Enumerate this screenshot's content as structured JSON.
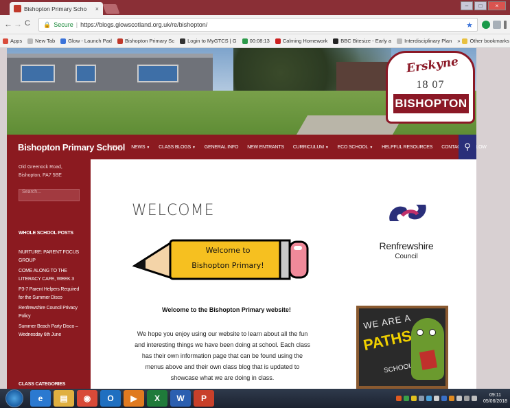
{
  "browser": {
    "tab_title": "Bishopton Primary Scho",
    "close_tab": "×",
    "secure_label": "Secure",
    "url": "https://blogs.glowscotland.org.uk/re/bishopton/",
    "back": "←",
    "forward": "→",
    "reload": "C",
    "window_controls": {
      "minimize": "–",
      "maximize": "□",
      "close": "×"
    }
  },
  "bookmarks": {
    "items": [
      {
        "label": "Apps",
        "color": "#d94c3c"
      },
      {
        "label": "New Tab",
        "color": "#bbbbbb"
      },
      {
        "label": "Glow - Launch Pad",
        "color": "#3b73d9"
      },
      {
        "label": "Bishopton Primary Sc",
        "color": "#c0392b"
      },
      {
        "label": "Login to MyGTCS | G",
        "color": "#333333"
      },
      {
        "label": "00:08:13",
        "color": "#2c9a4a"
      },
      {
        "label": "Calming Homework",
        "color": "#cc2020"
      },
      {
        "label": "BBC Bitesize - Early a",
        "color": "#222222"
      },
      {
        "label": "Interdisciplinary Plan",
        "color": "#bbbbbb"
      }
    ],
    "overflow": "»",
    "other": "Other bookmarks"
  },
  "logo": {
    "script": "Erskyne",
    "year": "18 07",
    "name": "BISHOPTON"
  },
  "nav": {
    "site_title": "Bishopton Primary School",
    "items": [
      {
        "label": "HOME",
        "caret": ""
      },
      {
        "label": "NEWS",
        "caret": "▼"
      },
      {
        "label": "CLASS BLOGS",
        "caret": "▼"
      },
      {
        "label": "GENERAL INFO",
        "caret": ""
      },
      {
        "label": "NEW ENTRANTS",
        "caret": ""
      },
      {
        "label": "CURRICULUM",
        "caret": "▼"
      },
      {
        "label": "ECO SCHOOL",
        "caret": "▼"
      },
      {
        "label": "HELPFUL RESOURCES",
        "caret": ""
      },
      {
        "label": "CONTACT",
        "caret": ""
      },
      {
        "label": "GLOW",
        "caret": ""
      }
    ],
    "search_icon": "⚲"
  },
  "sidebar": {
    "address_line1": "Old Greenock Road,",
    "address_line2": "Bishopton, PA7 5BE",
    "search_placeholder": "Search...",
    "posts_heading": "WHOLE SCHOOL POSTS",
    "posts": [
      "NURTURE: PARENT FOCUS GROUP",
      "COME ALONG TO THE LITERACY CAFE, WEEK 3",
      "P3-7 Parent Helpers Required for the Summer Disco",
      "Renfrewshire Council Privacy Policy",
      "Summer Beach Party Disco – Wednesday 6th June"
    ],
    "categories_heading": "CLASS CATEGORIES"
  },
  "content": {
    "heading": "WELCOME",
    "pencil_line1": "Welcome to",
    "pencil_line2": "Bishopton Primary!",
    "intro_title": "Welcome to the Bishopton Primary website!",
    "intro_body": "We hope you enjoy using our website to learn about all the fun and interesting things we have been doing at school. Each class has their own information page that can be found using the menus above and their own class blog that is updated to showcase what we are doing in class."
  },
  "renfrewshire": {
    "name": "Renfrewshire",
    "sub": "Council"
  },
  "paths_badge": {
    "line1": "WE ARE A",
    "line2": "PATHS",
    "line3": "SCHOOL"
  },
  "taskbar": {
    "apps": [
      {
        "label": "e",
        "color": "#2b79d0"
      },
      {
        "label": "▤",
        "color": "#e0b040"
      },
      {
        "label": "◉",
        "color": "#d84a38"
      },
      {
        "label": "O",
        "color": "#1f6fc0"
      },
      {
        "label": "▶",
        "color": "#e07a20"
      },
      {
        "label": "X",
        "color": "#1f7a3a"
      },
      {
        "label": "W",
        "color": "#2b5fb0"
      },
      {
        "label": "P",
        "color": "#c8402a"
      }
    ],
    "time": "09:11",
    "date": "05/06/2018"
  }
}
